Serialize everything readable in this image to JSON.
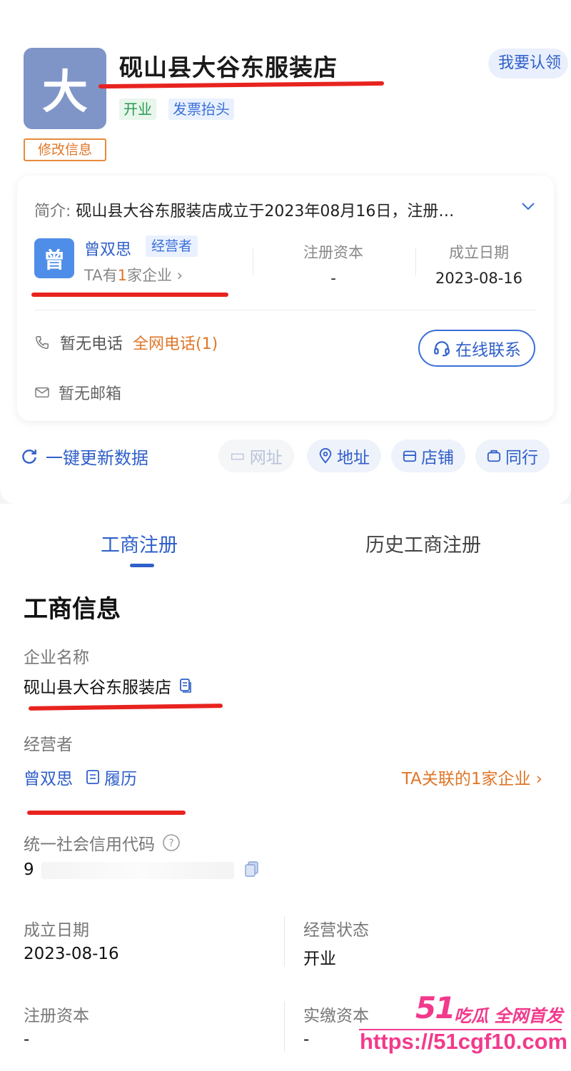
{
  "header": {
    "avatar_char": "大",
    "company_name": "砚山县大谷东服装店",
    "tags": [
      "开业",
      "发票抬头"
    ],
    "claim_label": "我要认领",
    "edit_label": "修改信息"
  },
  "summary": {
    "intro_label": "简介:",
    "intro_text": "砚山县大谷东服装店成立于2023年08月16日，注册…",
    "person_char": "曾",
    "person_name": "曾双思",
    "person_role": "经营者",
    "person_sub_prefix": "TA有",
    "person_sub_num": "1",
    "person_sub_suffix": "家企业",
    "capital_label": "注册资本",
    "capital_value": "-",
    "founded_label": "成立日期",
    "founded_value": "2023-08-16",
    "phone_text": "暂无电话",
    "phone_link": "全网电话(1)",
    "online_label": "在线联系",
    "mail_text": "暂无邮箱"
  },
  "actions": {
    "update_label": "一键更新数据",
    "pills": [
      {
        "label": "网址",
        "icon": "web-icon"
      },
      {
        "label": "地址",
        "icon": "location-icon"
      },
      {
        "label": "店铺",
        "icon": "store-icon"
      },
      {
        "label": "同行",
        "icon": "peer-icon"
      }
    ]
  },
  "tabs": [
    "工商注册",
    "历史工商注册"
  ],
  "details": {
    "section_title": "工商信息",
    "name_label": "企业名称",
    "name_value": "砚山县大谷东服装店",
    "operator_label": "经营者",
    "operator_value": "曾双思",
    "resume_label": "履历",
    "related_label": "TA关联的1家企业",
    "credit_label": "统一社会信用代码",
    "credit_value": "9",
    "founded_label": "成立日期",
    "founded_value": "2023-08-16",
    "status_label": "经营状态",
    "status_value": "开业",
    "reg_capital_label": "注册资本",
    "reg_capital_value": "-",
    "paid_capital_label": "实缴资本",
    "paid_capital_value": "-"
  },
  "watermark": {
    "num": "51",
    "text": "吃瓜 全网首发",
    "url": "https://51cgf10.com"
  },
  "colors": {
    "brand_blue": "#2f5fc9",
    "accent_orange": "#e07628",
    "annotation_red": "#e8231f",
    "watermark_pink": "#f23a8c"
  }
}
